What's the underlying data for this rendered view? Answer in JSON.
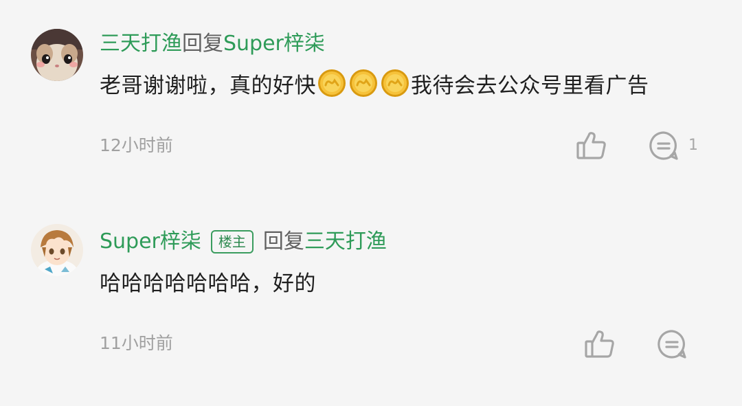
{
  "comments": [
    {
      "author": "三天打渔",
      "reply_word": "回复",
      "reply_to": "Super梓柒",
      "text_before": "老哥谢谢啦，真的好快",
      "emoji_name": "gold-coin-emoji",
      "emoji_count": 3,
      "text_after": "我待会去公众号里看广告",
      "time": "12小时前",
      "reply_count": "1"
    },
    {
      "author": "Super梓柒",
      "badge": "楼主",
      "reply_word": "回复",
      "reply_to": "三天打渔",
      "text": "哈哈哈哈哈哈哈，好的",
      "time": "11小时前"
    }
  ],
  "colors": {
    "name_green": "#2e9b58",
    "background": "#f5f5f5",
    "icon_grey": "#a6a6a6"
  },
  "icons": [
    "thumbs-up-icon",
    "comment-icon"
  ]
}
